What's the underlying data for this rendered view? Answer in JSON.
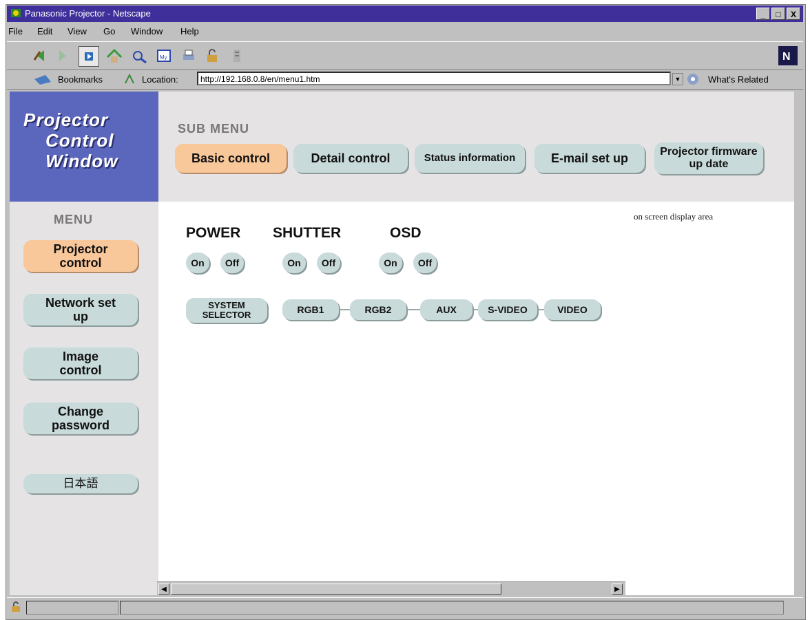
{
  "window": {
    "title": "Panasonic Projector - Netscape",
    "controls": [
      "_",
      "□",
      "X"
    ]
  },
  "menu_bar": [
    "File",
    "Edit",
    "View",
    "Go",
    "Window",
    "Help"
  ],
  "toolbar": {
    "icons": [
      "back-icon",
      "forward-icon",
      "reload-icon",
      "home-icon",
      "search-icon",
      "mynetscape-icon",
      "print-icon",
      "security-icon",
      "stop-icon"
    ]
  },
  "location_bar": {
    "bookmarks_label": "Bookmarks",
    "location_label": "Location:",
    "url": "http://192.168.0.8/en/menu1.htm",
    "related_label": "What's Related"
  },
  "page": {
    "logo_lines": [
      "Projector",
      "Control",
      "Window"
    ],
    "sub_menu_heading": "SUB MENU",
    "sub_menu": [
      {
        "label": "Basic control",
        "active": true
      },
      {
        "label": "Detail control",
        "active": false
      },
      {
        "label": "Status information",
        "active": false
      },
      {
        "label": "E-mail set up",
        "active": false
      },
      {
        "label": "Projector firmware up date",
        "active": false
      }
    ],
    "menu_heading": "MENU",
    "menu": [
      {
        "label": "Projector control",
        "active": true
      },
      {
        "label": "Network set up",
        "active": false
      },
      {
        "label": "Image control",
        "active": false
      },
      {
        "label": "Change password",
        "active": false
      },
      {
        "label": "日本語",
        "active": false
      }
    ],
    "osd_area_label": "on screen display area",
    "controls": {
      "power": {
        "label": "POWER",
        "on": "On",
        "off": "Off"
      },
      "shutter": {
        "label": "SHUTTER",
        "on": "On",
        "off": "Off"
      },
      "osd": {
        "label": "OSD",
        "on": "On",
        "off": "Off"
      }
    },
    "system_selector": "SYSTEM SELECTOR",
    "inputs": [
      "RGB1",
      "RGB2",
      "AUX",
      "S-VIDEO",
      "VIDEO"
    ]
  },
  "colors": {
    "titlebar": "#3e2f9a",
    "logo_bg": "#5b66bd",
    "button_normal": "#c8dad9",
    "button_active": "#f8c79a",
    "panel_bg": "#e6e3e4"
  }
}
